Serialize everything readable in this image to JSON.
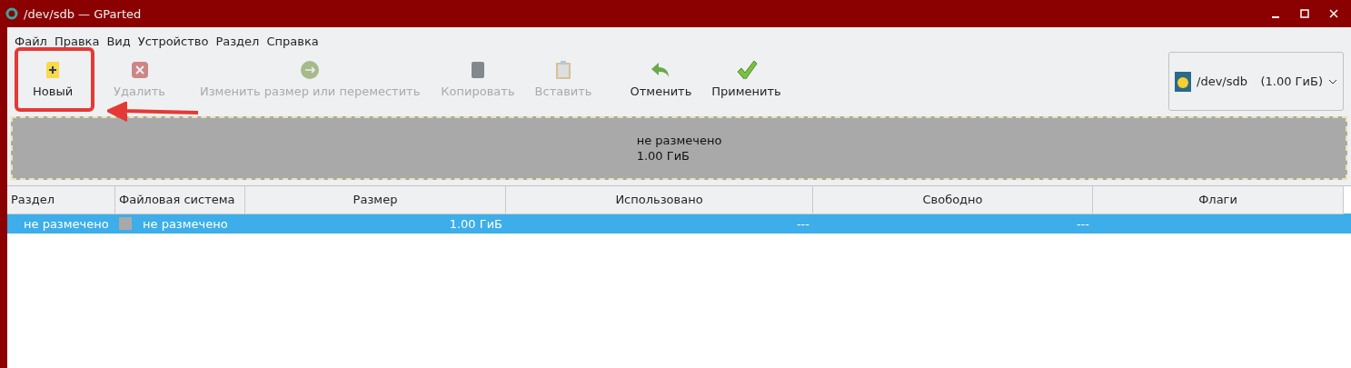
{
  "window": {
    "title": "/dev/sdb — GParted"
  },
  "menu": [
    "Файл",
    "Правка",
    "Вид",
    "Устройство",
    "Раздел",
    "Справка"
  ],
  "toolbar": [
    {
      "kind": "new",
      "label": "Новый",
      "disabled": false,
      "highlighted": true
    },
    {
      "kind": "delete",
      "label": "Удалить",
      "disabled": true,
      "highlighted": false
    },
    {
      "kind": "resize",
      "label": "Изменить размер или переместить",
      "disabled": true,
      "highlighted": false
    },
    {
      "kind": "copy",
      "label": "Копировать",
      "disabled": true,
      "highlighted": false
    },
    {
      "kind": "paste",
      "label": "Вставить",
      "disabled": true,
      "highlighted": false
    },
    {
      "kind": "undo",
      "label": "Отменить",
      "disabled": false,
      "highlighted": false
    },
    {
      "kind": "apply",
      "label": "Применить",
      "disabled": false,
      "highlighted": false
    }
  ],
  "device": {
    "name": "/dev/sdb",
    "size": "(1.00 ГиБ)"
  },
  "disk_map": [
    {
      "label": "не размечено",
      "size": "1.00 ГиБ"
    }
  ],
  "table": {
    "columns": [
      "Раздел",
      "Файловая система",
      "Размер",
      "Использовано",
      "Свободно",
      "Флаги"
    ],
    "rows": [
      {
        "selected": true,
        "cells": [
          "не размечено",
          "не размечено",
          "1.00 ГиБ",
          "---",
          "---",
          ""
        ]
      }
    ]
  }
}
